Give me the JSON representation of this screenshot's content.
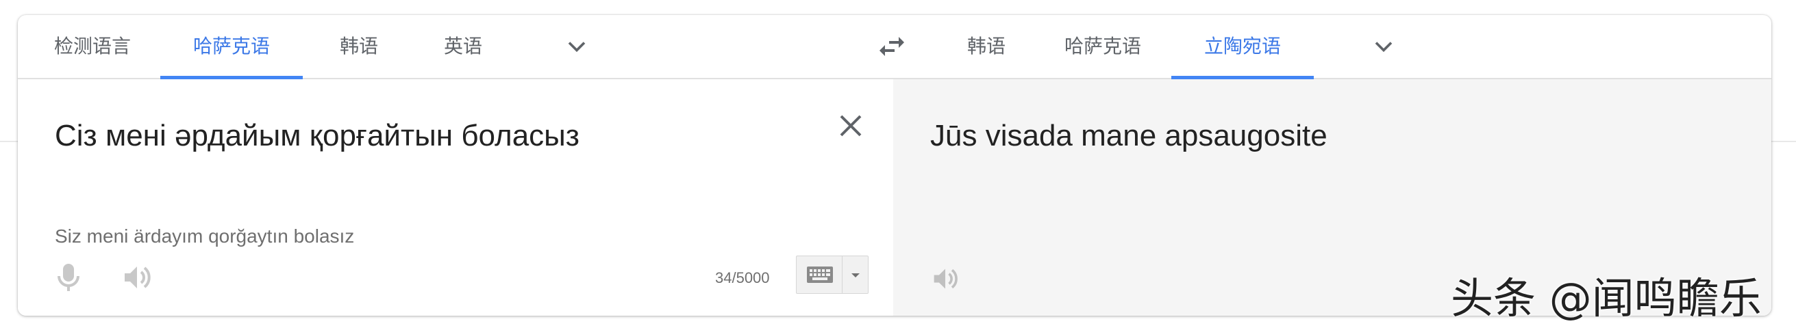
{
  "source_langs": {
    "tabs": [
      {
        "label": "检测语言",
        "active": false
      },
      {
        "label": "哈萨克语",
        "active": true
      },
      {
        "label": "韩语",
        "active": false
      },
      {
        "label": "英语",
        "active": false
      }
    ],
    "more_icon": "chevron-down-icon"
  },
  "swap_icon": "swap-horizontal-icon",
  "target_langs": {
    "tabs": [
      {
        "label": "韩语",
        "active": false
      },
      {
        "label": "哈萨克语",
        "active": false
      },
      {
        "label": "立陶宛语",
        "active": true
      }
    ],
    "more_icon": "chevron-down-icon"
  },
  "source": {
    "text": "Сіз мені әрдайым қорғайтын боласыз",
    "transliteration": "Siz meni ärdayım qorğaytın bolasız",
    "char_count": "34/5000",
    "clear_icon": "close-icon",
    "mic_icon": "microphone-icon",
    "speaker_icon": "speaker-icon",
    "keyboard_icon": "keyboard-icon"
  },
  "target": {
    "text": "Jūs visada mane apsaugosite",
    "speaker_icon": "speaker-icon"
  },
  "watermark": "头条 @闻鸣瞻乐",
  "colors": {
    "accent": "#4285f4",
    "active_text": "#3b78e7",
    "tab_text": "#5f6368",
    "target_bg": "#f5f5f5"
  }
}
